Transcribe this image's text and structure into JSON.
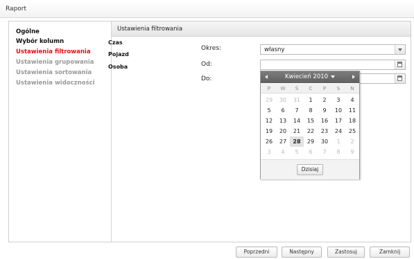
{
  "window": {
    "title": "Raport"
  },
  "nav": {
    "items": [
      {
        "label": "Ogólne",
        "state": "dark"
      },
      {
        "label": "Wybór kolumn",
        "state": "dark"
      },
      {
        "label": "Ustawienia filtrowania",
        "state": "active"
      },
      {
        "label": "Ustawienia grupowania",
        "state": "muted"
      },
      {
        "label": "Ustawienia sortowania",
        "state": "muted"
      },
      {
        "label": "Ustawienia widoczności",
        "state": "muted"
      }
    ]
  },
  "content": {
    "header": "Ustawienia filtrowania",
    "subnav": [
      "Czas",
      "Pojazd",
      "Osoba"
    ],
    "form": {
      "okres_label": "Okres:",
      "okres_value": "własny",
      "od_label": "Od:",
      "od_value": "",
      "do_label": "Do:",
      "do_value": ""
    }
  },
  "calendar": {
    "month_label": "Kwiecień 2010",
    "weekdays": [
      "P",
      "W",
      "Ś",
      "C",
      "P",
      "S",
      "N"
    ],
    "weeks": [
      [
        {
          "d": "29",
          "o": true
        },
        {
          "d": "30",
          "o": true
        },
        {
          "d": "31",
          "o": true
        },
        {
          "d": "1"
        },
        {
          "d": "2"
        },
        {
          "d": "3"
        },
        {
          "d": "4"
        }
      ],
      [
        {
          "d": "5"
        },
        {
          "d": "6"
        },
        {
          "d": "7"
        },
        {
          "d": "8"
        },
        {
          "d": "9"
        },
        {
          "d": "10"
        },
        {
          "d": "11"
        }
      ],
      [
        {
          "d": "12"
        },
        {
          "d": "13"
        },
        {
          "d": "14"
        },
        {
          "d": "15"
        },
        {
          "d": "16"
        },
        {
          "d": "17"
        },
        {
          "d": "18"
        }
      ],
      [
        {
          "d": "19"
        },
        {
          "d": "20"
        },
        {
          "d": "21"
        },
        {
          "d": "22"
        },
        {
          "d": "23"
        },
        {
          "d": "24"
        },
        {
          "d": "25"
        }
      ],
      [
        {
          "d": "26"
        },
        {
          "d": "27"
        },
        {
          "d": "28",
          "today": true
        },
        {
          "d": "29"
        },
        {
          "d": "30"
        },
        {
          "d": "1",
          "o": true
        },
        {
          "d": "2",
          "o": true
        }
      ],
      [
        {
          "d": "3",
          "o": true
        },
        {
          "d": "4",
          "o": true
        },
        {
          "d": "5",
          "o": true
        },
        {
          "d": "6",
          "o": true
        },
        {
          "d": "7",
          "o": true
        },
        {
          "d": "8",
          "o": true
        },
        {
          "d": "9",
          "o": true
        }
      ]
    ],
    "today_button": "Dzisiaj"
  },
  "footer": {
    "buttons": [
      "Poprzedni",
      "Następny",
      "Zastosuj",
      "Zamknij"
    ]
  },
  "colors": {
    "active_nav": "#e01010",
    "muted_nav": "#9a9a9a",
    "calendar_header": "#6e6e6e"
  }
}
